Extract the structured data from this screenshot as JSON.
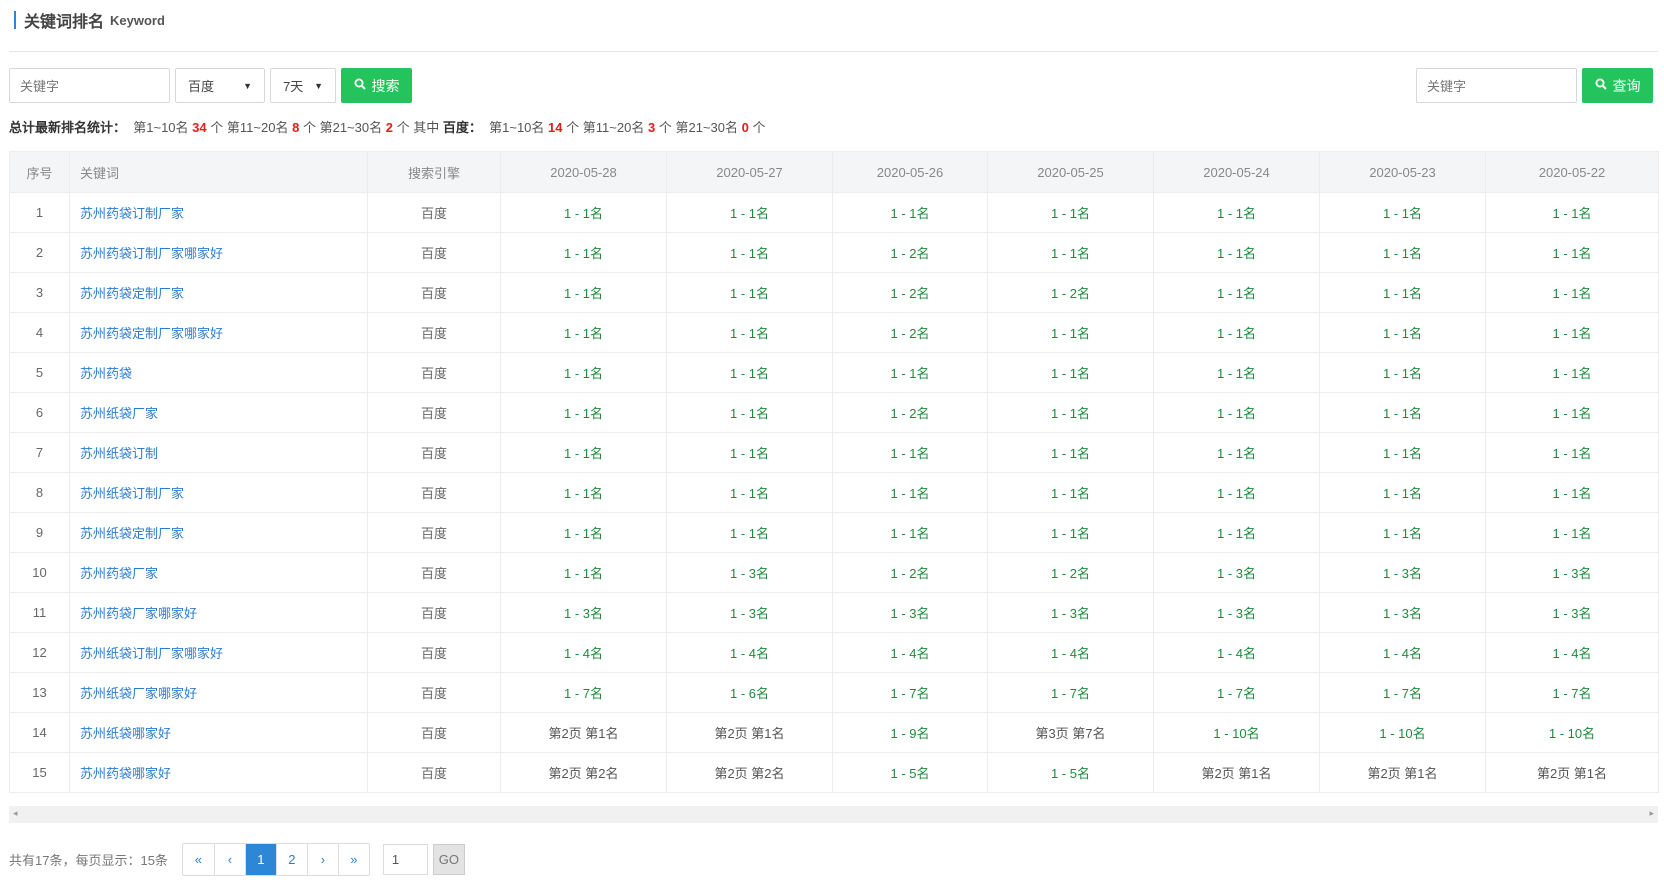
{
  "header": {
    "title_cn": "关键词排名",
    "title_en": "Keyword"
  },
  "toolbar": {
    "keyword_placeholder": "关键字",
    "engine_selected": "百度",
    "range_selected": "7天",
    "search_label": "搜索",
    "right_keyword_placeholder": "关键字",
    "query_label": "查询"
  },
  "stats": {
    "label": "总计最新排名统计：",
    "top10_label": "第1~10名",
    "top10_count": "34",
    "unit": "个",
    "top20_label": "第11~20名",
    "top20_count": "8",
    "top30_label": "第21~30名",
    "top30_count": "2",
    "among": "其中",
    "engine": "百度：",
    "b_top10_count": "14",
    "b_top20_count": "3",
    "b_top30_count": "0"
  },
  "table": {
    "headers": [
      "序号",
      "关键词",
      "搜索引擎",
      "2020-05-28",
      "2020-05-27",
      "2020-05-26",
      "2020-05-25",
      "2020-05-24",
      "2020-05-23",
      "2020-05-22"
    ],
    "rows": [
      [
        "1",
        "苏州药袋订制厂家",
        "百度",
        "1 - 1名",
        "1 - 1名",
        "1 - 1名",
        "1 - 1名",
        "1 - 1名",
        "1 - 1名",
        "1 - 1名"
      ],
      [
        "2",
        "苏州药袋订制厂家哪家好",
        "百度",
        "1 - 1名",
        "1 - 1名",
        "1 - 2名",
        "1 - 1名",
        "1 - 1名",
        "1 - 1名",
        "1 - 1名"
      ],
      [
        "3",
        "苏州药袋定制厂家",
        "百度",
        "1 - 1名",
        "1 - 1名",
        "1 - 2名",
        "1 - 2名",
        "1 - 1名",
        "1 - 1名",
        "1 - 1名"
      ],
      [
        "4",
        "苏州药袋定制厂家哪家好",
        "百度",
        "1 - 1名",
        "1 - 1名",
        "1 - 2名",
        "1 - 1名",
        "1 - 1名",
        "1 - 1名",
        "1 - 1名"
      ],
      [
        "5",
        "苏州药袋",
        "百度",
        "1 - 1名",
        "1 - 1名",
        "1 - 1名",
        "1 - 1名",
        "1 - 1名",
        "1 - 1名",
        "1 - 1名"
      ],
      [
        "6",
        "苏州纸袋厂家",
        "百度",
        "1 - 1名",
        "1 - 1名",
        "1 - 2名",
        "1 - 1名",
        "1 - 1名",
        "1 - 1名",
        "1 - 1名"
      ],
      [
        "7",
        "苏州纸袋订制",
        "百度",
        "1 - 1名",
        "1 - 1名",
        "1 - 1名",
        "1 - 1名",
        "1 - 1名",
        "1 - 1名",
        "1 - 1名"
      ],
      [
        "8",
        "苏州纸袋订制厂家",
        "百度",
        "1 - 1名",
        "1 - 1名",
        "1 - 1名",
        "1 - 1名",
        "1 - 1名",
        "1 - 1名",
        "1 - 1名"
      ],
      [
        "9",
        "苏州纸袋定制厂家",
        "百度",
        "1 - 1名",
        "1 - 1名",
        "1 - 1名",
        "1 - 1名",
        "1 - 1名",
        "1 - 1名",
        "1 - 1名"
      ],
      [
        "10",
        "苏州药袋厂家",
        "百度",
        "1 - 1名",
        "1 - 3名",
        "1 - 2名",
        "1 - 2名",
        "1 - 3名",
        "1 - 3名",
        "1 - 3名"
      ],
      [
        "11",
        "苏州药袋厂家哪家好",
        "百度",
        "1 - 3名",
        "1 - 3名",
        "1 - 3名",
        "1 - 3名",
        "1 - 3名",
        "1 - 3名",
        "1 - 3名"
      ],
      [
        "12",
        "苏州纸袋订制厂家哪家好",
        "百度",
        "1 - 4名",
        "1 - 4名",
        "1 - 4名",
        "1 - 4名",
        "1 - 4名",
        "1 - 4名",
        "1 - 4名"
      ],
      [
        "13",
        "苏州纸袋厂家哪家好",
        "百度",
        "1 - 7名",
        "1 - 6名",
        "1 - 7名",
        "1 - 7名",
        "1 - 7名",
        "1 - 7名",
        "1 - 7名"
      ],
      [
        "14",
        "苏州纸袋哪家好",
        "百度",
        "第2页 第1名",
        "第2页 第1名",
        "1 - 9名",
        "第3页 第7名",
        "1 - 10名",
        "1 - 10名",
        "1 - 10名"
      ],
      [
        "15",
        "苏州药袋哪家好",
        "百度",
        "第2页 第2名",
        "第2页 第2名",
        "1 - 5名",
        "1 - 5名",
        "第2页 第1名",
        "第2页 第1名",
        "第2页 第1名"
      ]
    ]
  },
  "pager": {
    "info": "共有17条，每页显示：15条",
    "first": "«",
    "prev": "‹",
    "pages": [
      "1",
      "2"
    ],
    "active": "1",
    "next": "›",
    "last": "»",
    "jump_value": "1",
    "go_label": "GO"
  },
  "colors": {
    "accent": "#2d86d6",
    "green_button": "#23c45b",
    "rank_green": "#1e8a3c",
    "stat_red": "#e0201a"
  }
}
